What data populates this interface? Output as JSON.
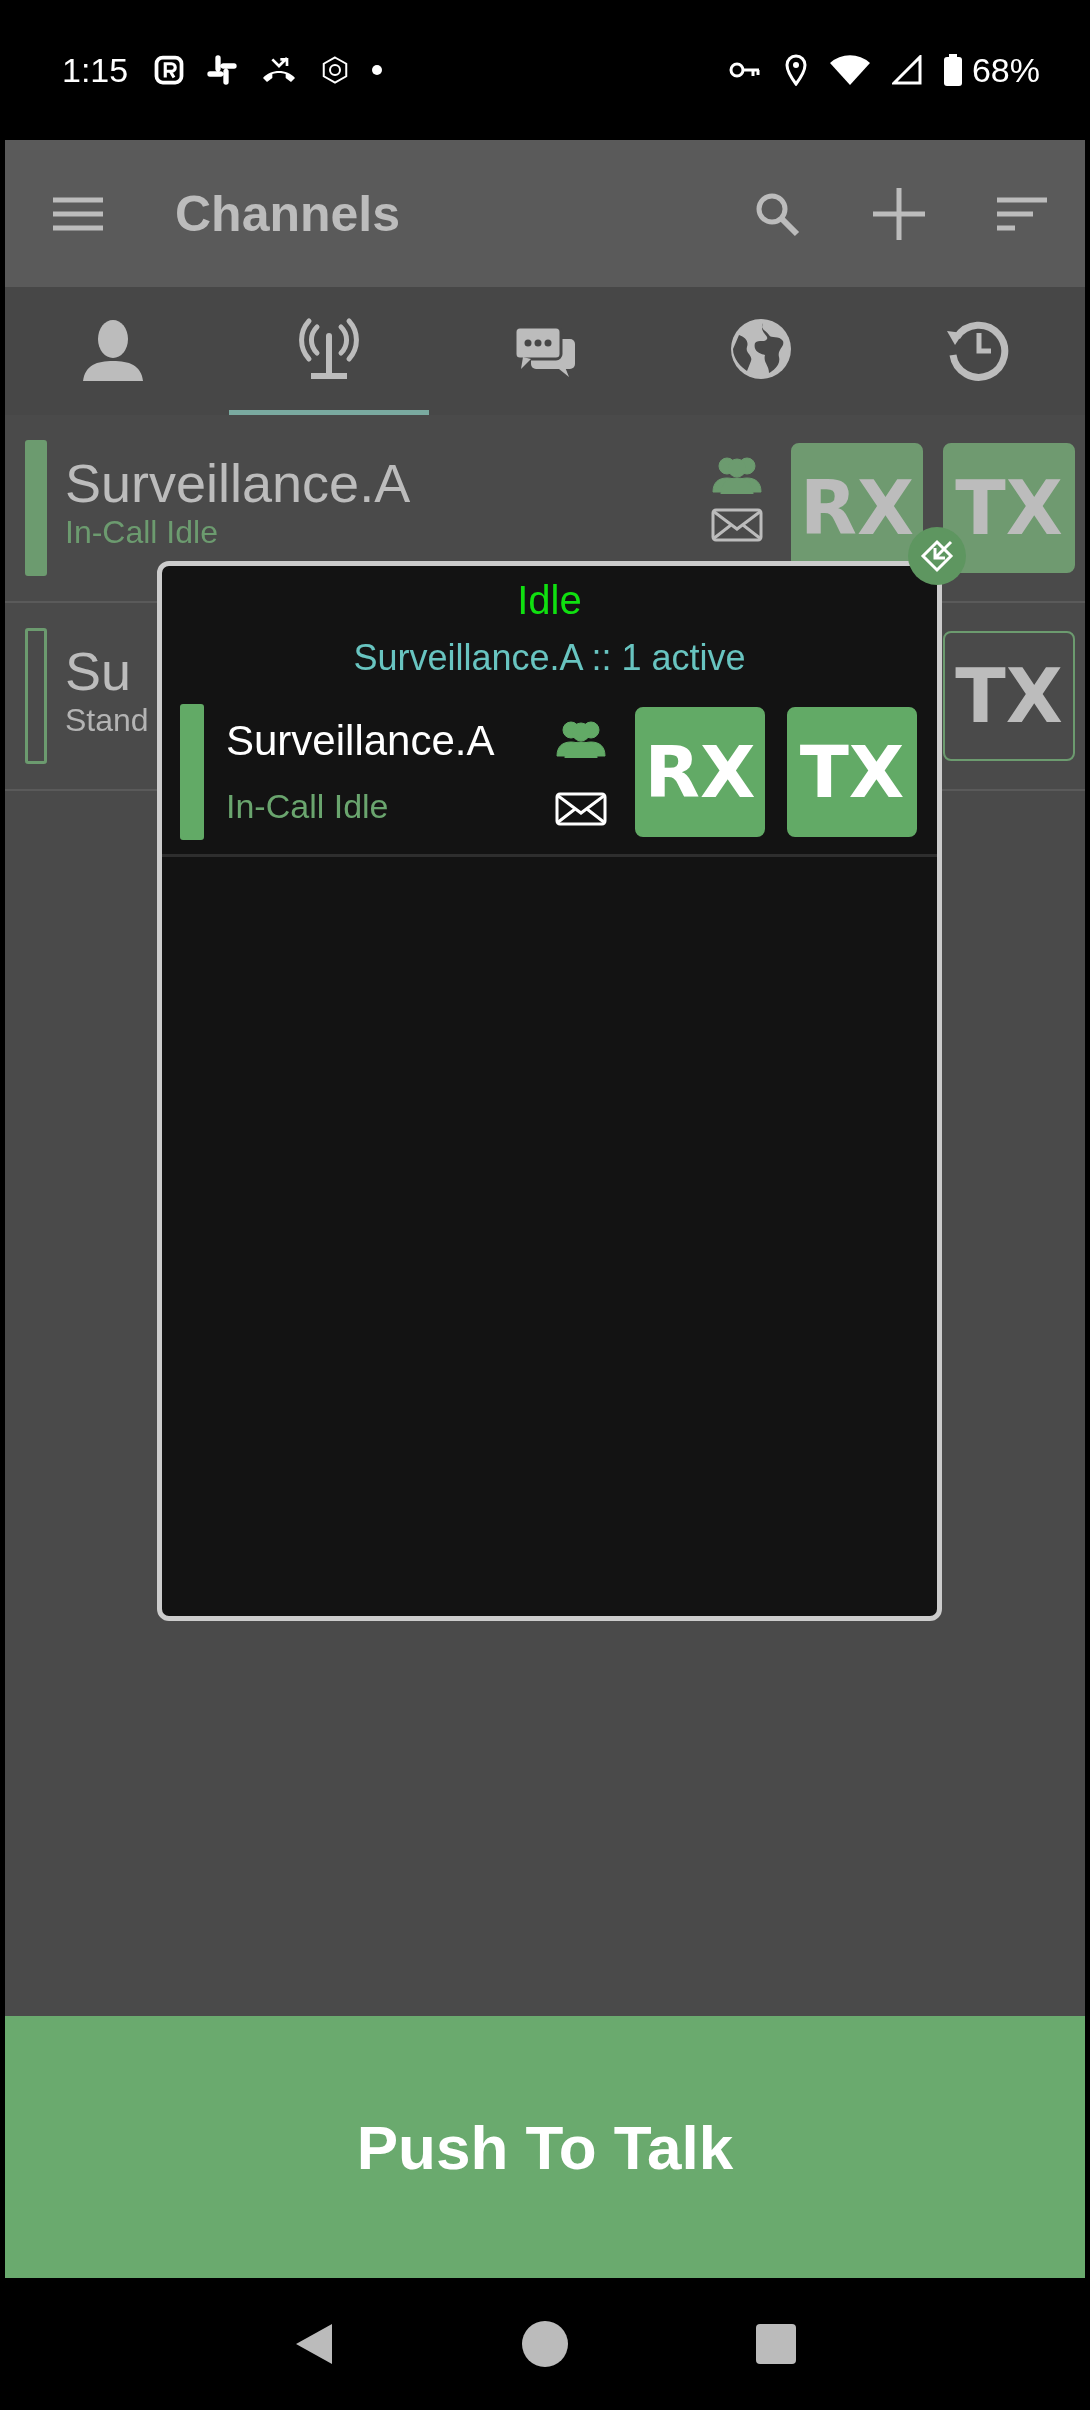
{
  "status_bar": {
    "time": "1:15",
    "battery": "68%"
  },
  "toolbar": {
    "title": "Channels"
  },
  "tabs": [
    {
      "selected": false
    },
    {
      "selected": true
    },
    {
      "selected": false
    },
    {
      "selected": false
    },
    {
      "selected": false
    }
  ],
  "channels": [
    {
      "name": "Surveillance.A",
      "status": "In-Call Idle",
      "active": true,
      "rx": "RX",
      "tx": "TX"
    },
    {
      "name": "Su",
      "status": "Stand",
      "active": false,
      "tx": "TX"
    }
  ],
  "popup": {
    "state": "Idle",
    "summary": "Surveillance.A :: 1 active",
    "channels": [
      {
        "name": "Surveillance.A",
        "status": "In-Call Idle",
        "active": true,
        "rx": "RX",
        "tx": "TX"
      }
    ]
  },
  "ptt_button": {
    "label": "Push To Talk"
  }
}
